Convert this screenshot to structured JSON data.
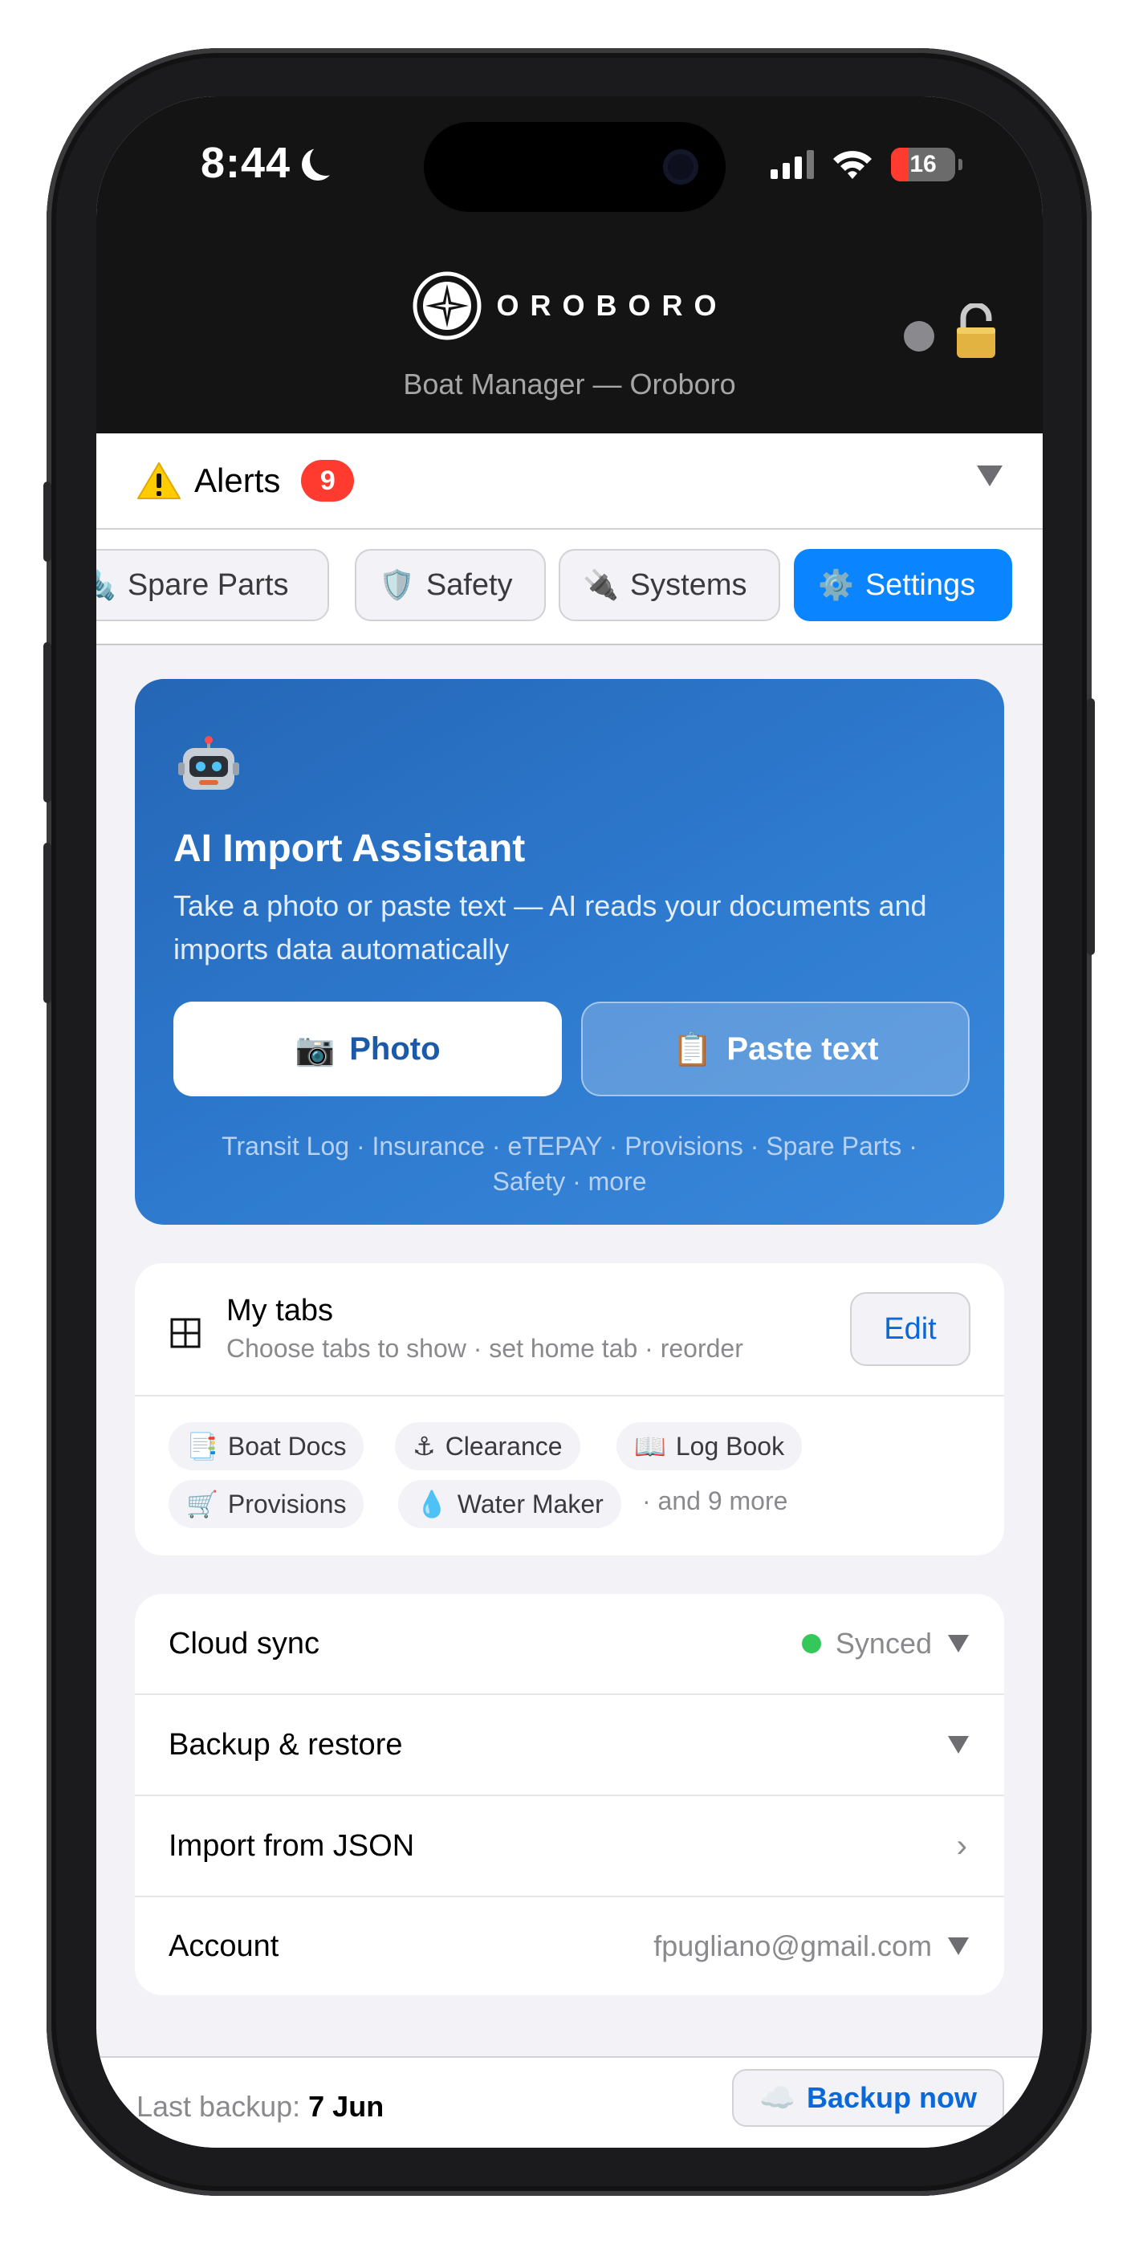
{
  "status_bar": {
    "time": "8:44",
    "battery": "16"
  },
  "header": {
    "brand": "OROBORO",
    "subtitle": "Boat Manager — Oroboro"
  },
  "alerts": {
    "label": "Alerts",
    "count": "9"
  },
  "tabs": [
    {
      "label": "Spare Parts",
      "icon": "🔩",
      "active": false
    },
    {
      "label": "Safety",
      "icon": "🛡️",
      "active": false
    },
    {
      "label": "Systems",
      "icon": "🔌",
      "active": false
    },
    {
      "label": "Settings",
      "icon": "⚙️",
      "active": true
    }
  ],
  "ai_import": {
    "icon": "robot-icon",
    "title": "AI Import Assistant",
    "description": "Take a photo or paste text — AI reads your documents and imports data automatically",
    "photo_button": "Photo",
    "photo_icon": "📷",
    "paste_button": "Paste text",
    "paste_icon": "📋",
    "supported": "Transit Log · Insurance · eTEPAY · Provisions · Spare Parts · Safety · more"
  },
  "my_tabs": {
    "title": "My tabs",
    "subtitle": "Choose tabs to show · set home tab · reorder",
    "edit_button": "Edit",
    "chips": [
      {
        "label": "Boat Docs",
        "icon": "📑"
      },
      {
        "label": "Clearance",
        "icon": "⚓"
      },
      {
        "label": "Log Book",
        "icon": "📖"
      },
      {
        "label": "Provisions",
        "icon": "🛒"
      },
      {
        "label": "Water Maker",
        "icon": "💧"
      }
    ],
    "more": "· and 9 more"
  },
  "settings_list": {
    "cloud_sync": {
      "label": "Cloud sync",
      "status": "Synced",
      "status_color": "#34c759"
    },
    "backup_restore": {
      "label": "Backup & restore"
    },
    "import_json": {
      "label": "Import from JSON"
    },
    "account": {
      "label": "Account",
      "email": "fpugliano@gmail.com"
    }
  },
  "bottom_bar": {
    "last_backup_label": "Last backup:",
    "last_backup_date": "7 Jun",
    "backup_button": "Backup now",
    "backup_icon": "☁️"
  },
  "colors": {
    "accent": "#0a84ff",
    "alert_badge": "#ff3b30",
    "synced": "#34c759"
  }
}
